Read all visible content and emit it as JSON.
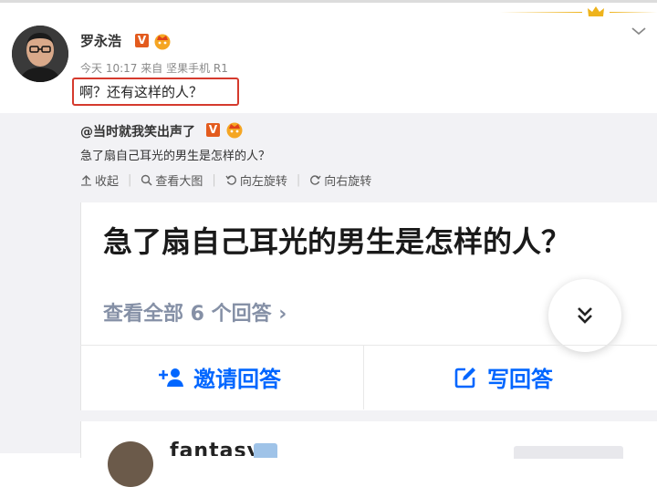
{
  "post": {
    "username": "罗永浩",
    "verified_badge": "V",
    "time": "今天 10:17",
    "source_prefix": "来自",
    "source": "坚果手机 R1",
    "text": "啊？还有这样的人？"
  },
  "repost": {
    "username": "@当时就我笑出声了",
    "verified_badge": "V",
    "text": "急了扇自己耳光的男生是怎样的人？",
    "actions": [
      {
        "label": "收起",
        "icon": "collapse-icon"
      },
      {
        "label": "查看大图",
        "icon": "magnify-icon"
      },
      {
        "label": "向左旋转",
        "icon": "rotate-left-icon"
      },
      {
        "label": "向右旋转",
        "icon": "rotate-right-icon"
      }
    ]
  },
  "screenshot": {
    "question_title": "急了扇自己耳光的男生是怎样的人？",
    "view_all": "查看全部 6 个回答 ›",
    "invite_label": "邀请回答",
    "write_label": "写回答",
    "answer_author": "fantasy"
  },
  "colors": {
    "accent_blue": "#0066ff",
    "highlight_red": "#d53a2d",
    "verified_orange": "#e35b1e",
    "gold": "#eeb31c",
    "muted": "#8590a6"
  }
}
